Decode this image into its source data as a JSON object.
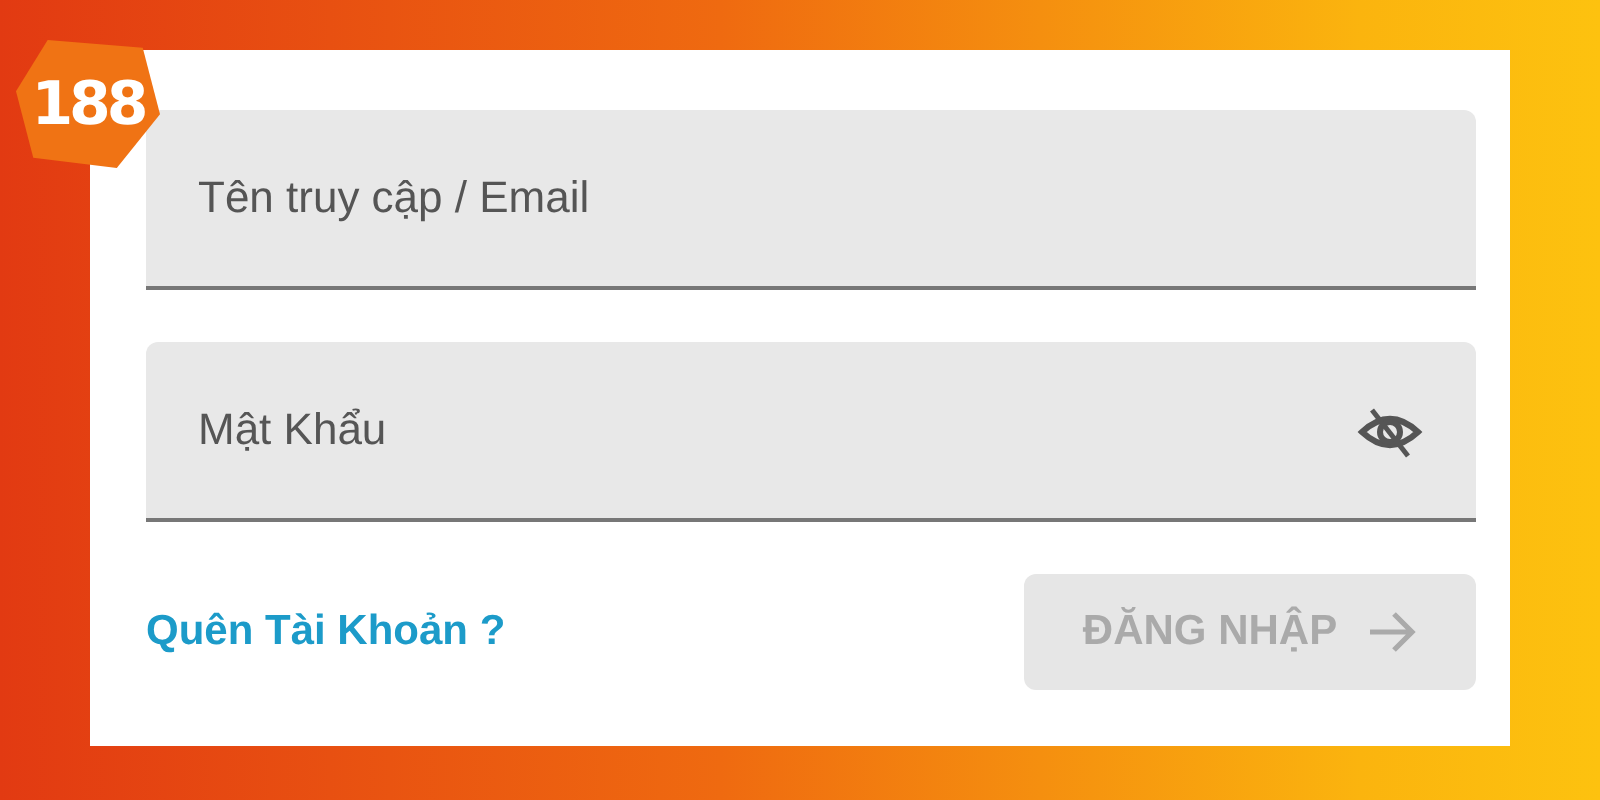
{
  "logo": {
    "text": "188"
  },
  "fields": [
    {
      "kind": "text",
      "placeholder": "Tên truy cập / Email"
    },
    {
      "kind": "password",
      "placeholder": "Mật Khẩu"
    }
  ],
  "forgot_link": "Quên Tài Khoản ?",
  "login_button": {
    "label": "ĐĂNG NHẬP",
    "disabled": true
  }
}
